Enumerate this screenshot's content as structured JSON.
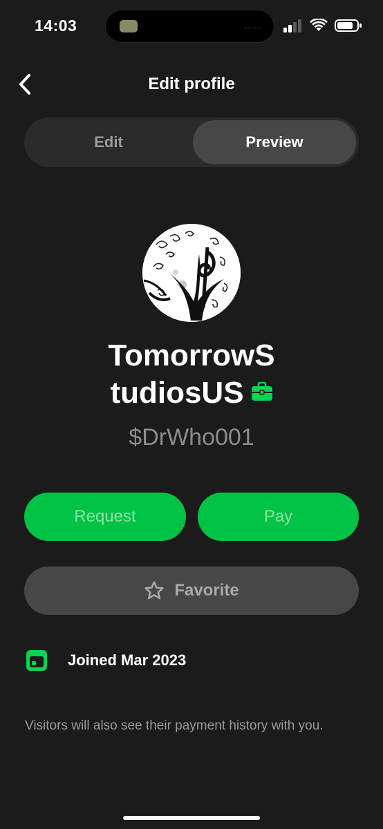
{
  "status_bar": {
    "time": "14:03",
    "island_dots": "......",
    "icons": [
      "cellular-signal-icon",
      "wifi-icon",
      "battery-icon"
    ]
  },
  "header": {
    "title": "Edit profile",
    "back_icon": "chevron-left-icon"
  },
  "tabs": [
    {
      "label": "Edit",
      "selected": false
    },
    {
      "label": "Preview",
      "selected": true
    }
  ],
  "profile": {
    "name_line1": "TomorrowS",
    "name_line2": "tudiosUS",
    "badge_icon": "briefcase-icon",
    "cashtag": "$DrWho001",
    "avatar": "music-treble-clef-tree-avatar"
  },
  "actions": {
    "request_label": "Request",
    "pay_label": "Pay",
    "favorite_label": "Favorite",
    "favorite_icon": "star-outline-icon"
  },
  "joined": {
    "icon": "calendar-icon",
    "text": "Joined Mar 2023"
  },
  "note": "Visitors will also see their payment history with you.",
  "colors": {
    "background": "#1b1b1b",
    "accent_green": "#00c244",
    "badge_green": "#00d64f",
    "segment_bg": "#2b2b2b",
    "segment_selected": "#474747"
  }
}
